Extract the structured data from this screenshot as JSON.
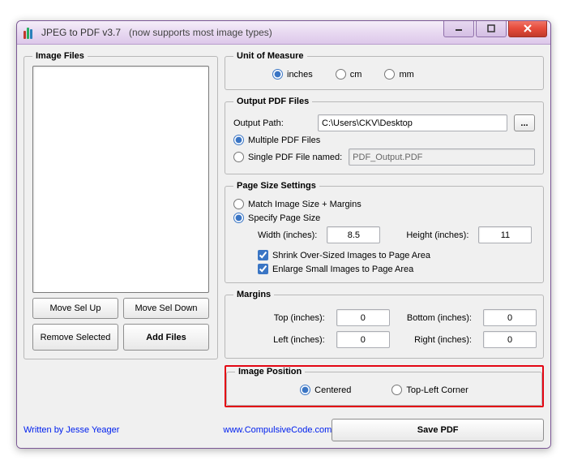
{
  "title": "JPEG to PDF  v3.7",
  "title_sub": "(now supports most image types)",
  "left": {
    "legend": "Image Files",
    "move_up": "Move Sel Up",
    "move_down": "Move Sel Down",
    "remove": "Remove Selected",
    "add": "Add Files"
  },
  "unit": {
    "legend": "Unit of Measure",
    "inches": "inches",
    "cm": "cm",
    "mm": "mm"
  },
  "output": {
    "legend": "Output PDF Files",
    "path_lbl": "Output Path:",
    "path_val": "C:\\Users\\CKV\\Desktop",
    "browse": "...",
    "multi": "Multiple PDF Files",
    "single": "Single PDF File named:",
    "single_val": "PDF_Output.PDF"
  },
  "page": {
    "legend": "Page Size Settings",
    "match": "Match Image Size + Margins",
    "specify": "Specify Page Size",
    "width_lbl": "Width (inches):",
    "width_val": "8.5",
    "height_lbl": "Height (inches):",
    "height_val": "11",
    "shrink": "Shrink Over-Sized Images to Page Area",
    "enlarge": "Enlarge Small Images to Page Area"
  },
  "margins": {
    "legend": "Margins",
    "top_lbl": "Top (inches):",
    "top_val": "0",
    "bottom_lbl": "Bottom (inches):",
    "bottom_val": "0",
    "left_lbl": "Left (inches):",
    "left_val": "0",
    "right_lbl": "Right (inches):",
    "right_val": "0"
  },
  "pos": {
    "legend": "Image Position",
    "centered": "Centered",
    "topleft": "Top-Left Corner"
  },
  "footer": {
    "author": "Written by Jesse Yeager",
    "site": "www.CompulsiveCode.com",
    "save": "Save PDF"
  }
}
